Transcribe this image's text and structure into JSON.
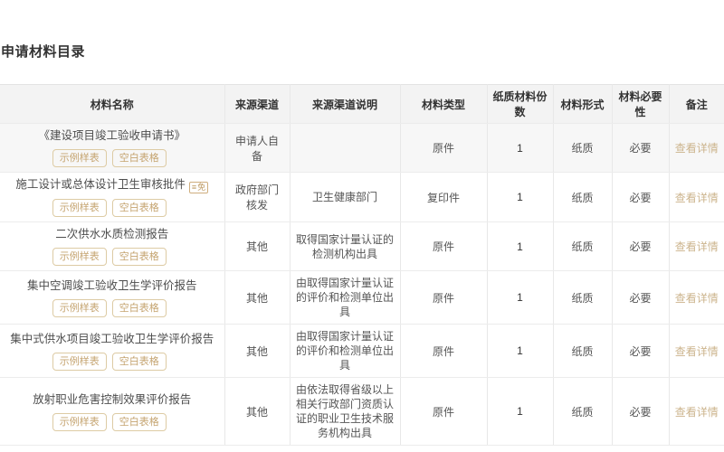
{
  "page": {
    "title": "申请材料目录"
  },
  "colors": {
    "accent": "#c5a470",
    "accent_border": "#ddcba4",
    "link": "#ccb48d",
    "border": "#e8e8e8",
    "header_bg": "#f3f3f3",
    "alt_row_bg": "#f7f7f7",
    "heading_text": "#333333",
    "body_text": "#555555"
  },
  "table": {
    "headers": [
      "材料名称",
      "来源渠道",
      "来源渠道说明",
      "材料类型",
      "纸质材料份数",
      "材料形式",
      "材料必要性",
      "备注"
    ],
    "sample_button": "示例样表",
    "blank_button": "空白表格",
    "detail_link": "查看详情",
    "exempt_icon_label": "免",
    "rows": [
      {
        "name": "《建设项目竣工验收申请书》",
        "has_exempt_icon": false,
        "source": "申请人自备",
        "source_desc": "",
        "type": "原件",
        "copies": "1",
        "form": "纸质",
        "necessity": "必要",
        "highlight": true
      },
      {
        "name": "施工设计或总体设计卫生审核批件",
        "has_exempt_icon": true,
        "source": "政府部门核发",
        "source_desc": "卫生健康部门",
        "type": "复印件",
        "copies": "1",
        "form": "纸质",
        "necessity": "必要",
        "highlight": false
      },
      {
        "name": "二次供水水质检测报告",
        "has_exempt_icon": false,
        "source": "其他",
        "source_desc": "取得国家计量认证的检测机构出具",
        "type": "原件",
        "copies": "1",
        "form": "纸质",
        "necessity": "必要",
        "highlight": false
      },
      {
        "name": "集中空调竣工验收卫生学评价报告",
        "has_exempt_icon": false,
        "source": "其他",
        "source_desc": "由取得国家计量认证的评价和检测单位出具",
        "type": "原件",
        "copies": "1",
        "form": "纸质",
        "necessity": "必要",
        "highlight": false
      },
      {
        "name": "集中式供水项目竣工验收卫生学评价报告",
        "has_exempt_icon": false,
        "source": "其他",
        "source_desc": "由取得国家计量认证的评价和检测单位出具",
        "type": "原件",
        "copies": "1",
        "form": "纸质",
        "necessity": "必要",
        "highlight": false
      },
      {
        "name": "放射职业危害控制效果评价报告",
        "has_exempt_icon": false,
        "source": "其他",
        "source_desc": "由依法取得省级以上相关行政部门资质认证的职业卫生技术服务机构出具",
        "type": "原件",
        "copies": "1",
        "form": "纸质",
        "necessity": "必要",
        "highlight": false
      }
    ]
  }
}
